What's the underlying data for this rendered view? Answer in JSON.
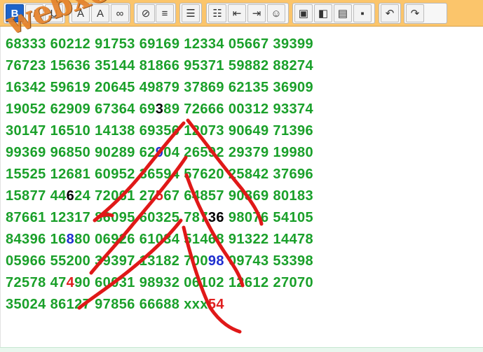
{
  "toolbar": {
    "buttons": [
      {
        "name": "bold-button",
        "glyph": "B",
        "icon": "bold-icon",
        "active": true
      },
      {
        "name": "italic-button",
        "glyph": "I",
        "icon": "italic-icon"
      },
      {
        "name": "underline-button",
        "glyph": "U",
        "icon": "underline-icon"
      },
      {
        "name": "text-color-button",
        "glyph": "A",
        "icon": "text-color-icon"
      },
      {
        "name": "font-size-button",
        "glyph": "A",
        "icon": "font-size-icon"
      },
      {
        "name": "link-button",
        "glyph": "∞",
        "icon": "link-icon"
      },
      {
        "name": "unlink-button",
        "glyph": "⊘",
        "icon": "unlink-icon"
      },
      {
        "name": "align-left-button",
        "glyph": "≡",
        "icon": "align-left-icon"
      },
      {
        "name": "bullet-list-button",
        "glyph": "☰",
        "icon": "bullet-list-icon"
      },
      {
        "name": "numbered-list-button",
        "glyph": "☷",
        "icon": "numbered-list-icon"
      },
      {
        "name": "outdent-button",
        "glyph": "⇤",
        "icon": "outdent-icon"
      },
      {
        "name": "indent-button",
        "glyph": "⇥",
        "icon": "indent-icon"
      },
      {
        "name": "emoji-button",
        "glyph": "☺",
        "icon": "emoji-icon"
      },
      {
        "name": "image-button",
        "glyph": "▣",
        "icon": "image-icon"
      },
      {
        "name": "gallery-button",
        "glyph": "◧",
        "icon": "gallery-icon"
      },
      {
        "name": "document-button",
        "glyph": "▤",
        "icon": "document-icon"
      },
      {
        "name": "save-button",
        "glyph": "▪",
        "icon": "save-icon"
      },
      {
        "name": "undo-button",
        "glyph": "↶",
        "icon": "undo-icon"
      },
      {
        "name": "redo-button",
        "glyph": "↷",
        "icon": "redo-icon"
      }
    ]
  },
  "watermark": "webxoso.net",
  "rows": [
    [
      {
        "t": "68333 "
      },
      {
        "t": "60212 91753 69169 12334 05667 39399"
      }
    ],
    [
      {
        "t": "76723 15636 35144 81866 95371 59882 88274"
      }
    ],
    [
      {
        "t": "16342 59619 20645 49879 37869 62135 36909"
      }
    ],
    [
      {
        "t": "19052 62909 67364 69"
      },
      {
        "t": "3",
        "c": "#000000"
      },
      {
        "t": "89 72666 00312 93374"
      }
    ],
    [
      {
        "t": "30147 16510 14138 69356 12073 90649 71396"
      }
    ],
    [
      {
        "t": "99369 96850 90289 62"
      },
      {
        "t": "9",
        "c": "#1f2fd0"
      },
      {
        "t": "04 26592 29379 19980"
      }
    ],
    [
      {
        "t": "15525 12681 60952 36594 57620 25842 37696"
      }
    ],
    [
      {
        "t": "15877 44"
      },
      {
        "t": "6",
        "c": "#000000"
      },
      {
        "t": "24 72061 27"
      },
      {
        "t": "5",
        "c": "#e02020"
      },
      {
        "t": "67 64857 90869 80183"
      }
    ],
    [
      {
        "t": "87661 12317 86095 60325 787"
      },
      {
        "t": "36",
        "c": "#000000"
      },
      {
        "t": " 98076 54105"
      }
    ],
    [
      {
        "t": "84396 16"
      },
      {
        "t": "8",
        "c": "#1f2fd0"
      },
      {
        "t": "80 06926 61034 51468 91322 14478"
      }
    ],
    [
      {
        "t": "05966 55200 39397 13182 700"
      },
      {
        "t": "98",
        "c": "#1f2fd0"
      },
      {
        "t": " 09743 53398"
      }
    ],
    [
      {
        "t": "72578 47"
      },
      {
        "t": "4",
        "c": "#e02020"
      },
      {
        "t": "90 60031 98932 06102 12612 27070"
      }
    ],
    [
      {
        "t": "35024 86127 97856 66688 xxx"
      },
      {
        "t": "54",
        "c": "#e02020"
      }
    ]
  ],
  "colors": {
    "digits": "#1aa02a",
    "toolbar": "#fbc56b",
    "ink": "#e01818"
  }
}
